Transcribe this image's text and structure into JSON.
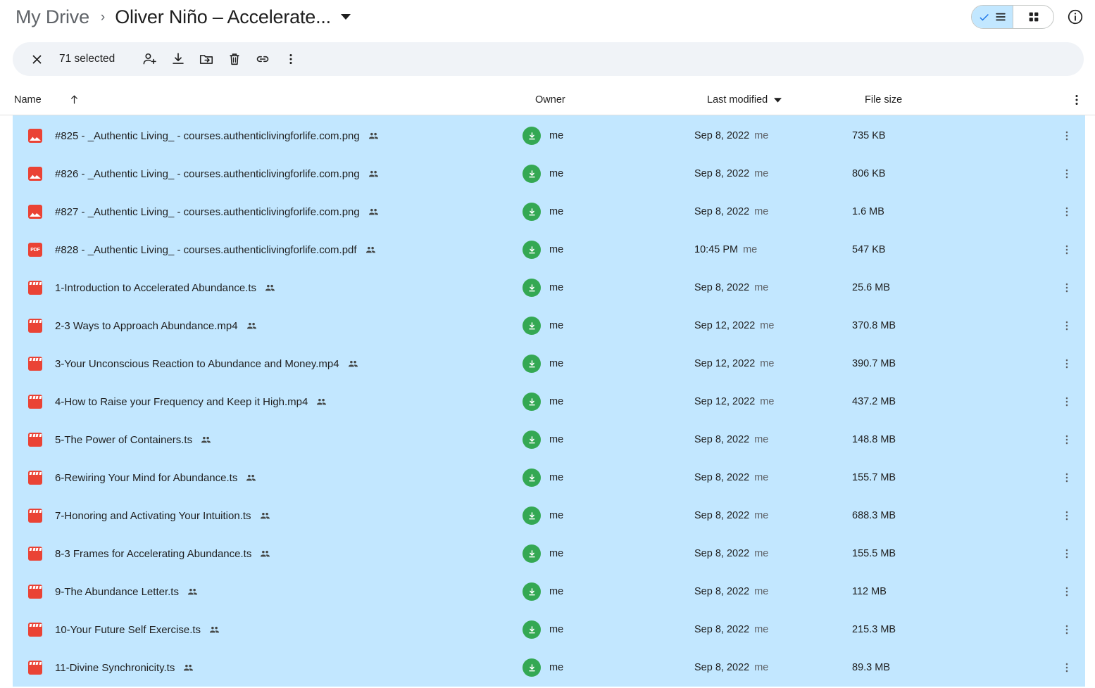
{
  "breadcrumb": {
    "root": "My Drive",
    "separator": "›",
    "current": "Oliver Niño – Accelerate...",
    "caret_icon": "chevron-down-icon"
  },
  "view_controls": {
    "list_view_label": "List view",
    "grid_view_label": "Grid view",
    "active_view": "list",
    "details_label": "View details",
    "active_bg": "#c2e7ff"
  },
  "selection_toolbar": {
    "close_label": "Clear selection",
    "count_text": "71 selected",
    "actions": [
      {
        "name": "share-icon",
        "label": "Share"
      },
      {
        "name": "download-icon",
        "label": "Download"
      },
      {
        "name": "move-to-folder-icon",
        "label": "Move to"
      },
      {
        "name": "trash-icon",
        "label": "Remove"
      },
      {
        "name": "link-icon",
        "label": "Get link"
      },
      {
        "name": "more-vert-icon",
        "label": "More actions"
      }
    ],
    "background": "#f0f3f7"
  },
  "columns": {
    "name": "Name",
    "name_sort": "↑",
    "owner": "Owner",
    "last_modified": "Last modified",
    "last_modified_sort": "▾",
    "file_size": "File size",
    "more": "more-vert-icon"
  },
  "list": {
    "selection_color": "#c2e7ff",
    "rows": [
      {
        "icon": "image-file-icon",
        "name": "#825 - _Authentic Living_ - courses.authenticlivingforlife.com.png",
        "shared": true,
        "owner": "me",
        "modified": "Sep 8, 2022",
        "modified_by": "me",
        "size": "735 KB"
      },
      {
        "icon": "image-file-icon",
        "name": "#826 - _Authentic Living_ - courses.authenticlivingforlife.com.png",
        "shared": true,
        "owner": "me",
        "modified": "Sep 8, 2022",
        "modified_by": "me",
        "size": "806 KB"
      },
      {
        "icon": "image-file-icon",
        "name": "#827 - _Authentic Living_ - courses.authenticlivingforlife.com.png",
        "shared": true,
        "owner": "me",
        "modified": "Sep 8, 2022",
        "modified_by": "me",
        "size": "1.6 MB"
      },
      {
        "icon": "pdf-file-icon",
        "name": "#828 - _Authentic Living_ - courses.authenticlivingforlife.com.pdf",
        "shared": true,
        "owner": "me",
        "modified": "10:45 PM",
        "modified_by": "me",
        "size": "547 KB"
      },
      {
        "icon": "video-file-icon",
        "name": "1-Introduction to Accelerated Abundance.ts",
        "shared": true,
        "owner": "me",
        "modified": "Sep 8, 2022",
        "modified_by": "me",
        "size": "25.6 MB"
      },
      {
        "icon": "video-file-icon",
        "name": "2-3 Ways to Approach Abundance.mp4",
        "shared": true,
        "owner": "me",
        "modified": "Sep 12, 2022",
        "modified_by": "me",
        "size": "370.8 MB"
      },
      {
        "icon": "video-file-icon",
        "name": "3-Your Unconscious Reaction to Abundance and Money.mp4",
        "shared": true,
        "owner": "me",
        "modified": "Sep 12, 2022",
        "modified_by": "me",
        "size": "390.7 MB"
      },
      {
        "icon": "video-file-icon",
        "name": "4-How to Raise your Frequency and Keep it High.mp4",
        "shared": true,
        "owner": "me",
        "modified": "Sep 12, 2022",
        "modified_by": "me",
        "size": "437.2 MB"
      },
      {
        "icon": "video-file-icon",
        "name": "5-The Power of Containers.ts",
        "shared": true,
        "owner": "me",
        "modified": "Sep 8, 2022",
        "modified_by": "me",
        "size": "148.8 MB"
      },
      {
        "icon": "video-file-icon",
        "name": "6-Rewiring Your Mind for Abundance.ts",
        "shared": true,
        "owner": "me",
        "modified": "Sep 8, 2022",
        "modified_by": "me",
        "size": "155.7 MB"
      },
      {
        "icon": "video-file-icon",
        "name": "7-Honoring and Activating Your Intuition.ts",
        "shared": true,
        "owner": "me",
        "modified": "Sep 8, 2022",
        "modified_by": "me",
        "size": "688.3 MB"
      },
      {
        "icon": "video-file-icon",
        "name": "8-3 Frames for Accelerating Abundance.ts",
        "shared": true,
        "owner": "me",
        "modified": "Sep 8, 2022",
        "modified_by": "me",
        "size": "155.5 MB"
      },
      {
        "icon": "video-file-icon",
        "name": "9-The Abundance Letter.ts",
        "shared": true,
        "owner": "me",
        "modified": "Sep 8, 2022",
        "modified_by": "me",
        "size": "112 MB"
      },
      {
        "icon": "video-file-icon",
        "name": "10-Your Future Self Exercise.ts",
        "shared": true,
        "owner": "me",
        "modified": "Sep 8, 2022",
        "modified_by": "me",
        "size": "215.3 MB"
      },
      {
        "icon": "video-file-icon",
        "name": "11-Divine Synchronicity.ts",
        "shared": true,
        "owner": "me",
        "modified": "Sep 8, 2022",
        "modified_by": "me",
        "size": "89.3 MB"
      }
    ]
  }
}
